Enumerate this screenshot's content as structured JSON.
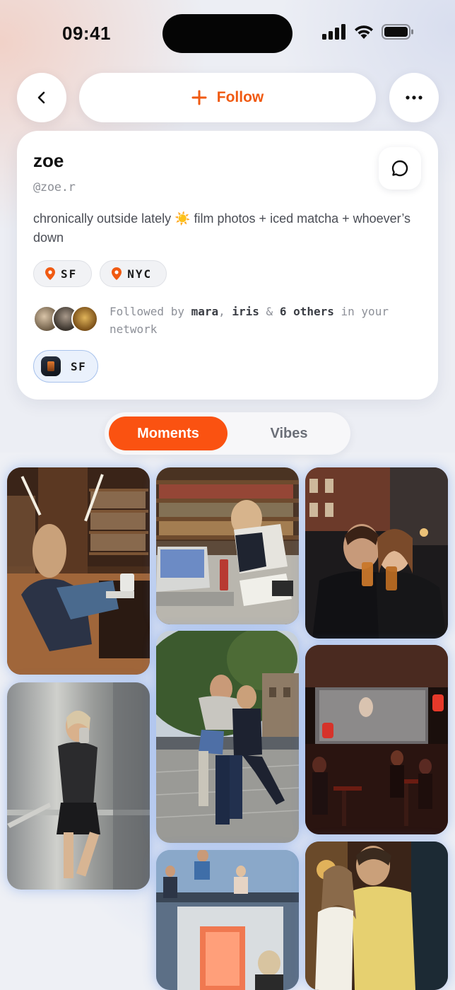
{
  "status_bar": {
    "time": "09:41"
  },
  "header": {
    "follow_label": "Follow"
  },
  "profile": {
    "name": "zoe",
    "handle": "@zoe.r",
    "bio": "chronically outside lately ☀️ film photos + iced matcha + whoever’s down",
    "locations": [
      "SF",
      "NYC"
    ],
    "followed_by": {
      "prefix": "Followed by ",
      "user1": "mara",
      "sep": ", ",
      "user2": "iris",
      "amp": " & ",
      "others": "6 others",
      "suffix": " in your network"
    },
    "current_location": "SF"
  },
  "tabs": {
    "active": "Moments",
    "inactive": "Vibes"
  },
  "colors": {
    "accent": "#fa5211",
    "follow_text": "#f05a12",
    "pill_blue": "#a9c3ec"
  },
  "icons": [
    "back-chevron-icon",
    "plus-icon",
    "more-dots-icon",
    "chat-bubble-icon",
    "location-pin-icon",
    "signal-icon",
    "wifi-icon",
    "battery-icon"
  ]
}
